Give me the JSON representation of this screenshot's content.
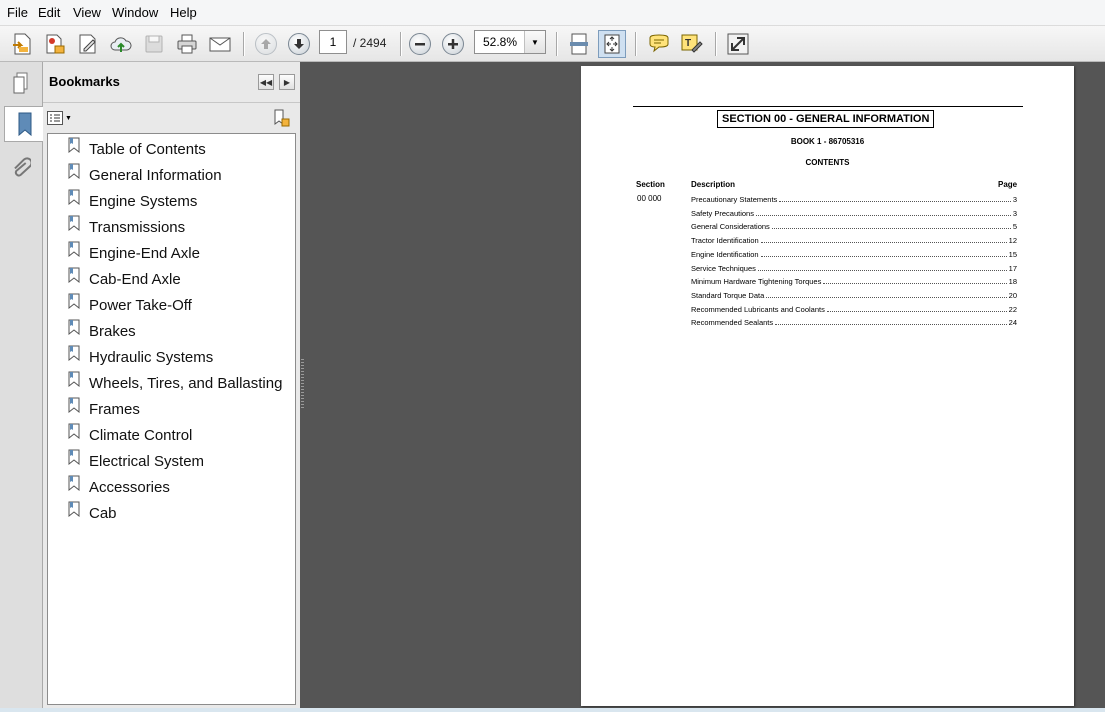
{
  "menu": [
    "File",
    "Edit",
    "View",
    "Window",
    "Help"
  ],
  "toolbar": {
    "page_current": "1",
    "page_total": "/ 2494",
    "zoom": "52.8%"
  },
  "panel": {
    "title": "Bookmarks"
  },
  "bookmarks": [
    "Table of Contents",
    "General Information",
    "Engine Systems",
    "Transmissions",
    "Engine-End Axle",
    "Cab-End Axle",
    "Power Take-Off",
    "Brakes",
    "Hydraulic Systems",
    "Wheels, Tires, and Ballasting",
    "Frames",
    "Climate Control",
    "Electrical System",
    "Accessories",
    "Cab"
  ],
  "document": {
    "section_title": "SECTION 00 - GENERAL INFORMATION",
    "book": "BOOK 1 - 86705316",
    "contents_heading": "CONTENTS",
    "col_section": "Section",
    "col_description": "Description",
    "col_page": "Page",
    "section_number": "00  000",
    "toc": [
      {
        "desc": "Precautionary Statements",
        "page": "3"
      },
      {
        "desc": "Safety Precautions",
        "page": "3"
      },
      {
        "desc": "General Considerations",
        "page": "5"
      },
      {
        "desc": "Tractor Identification",
        "page": "12"
      },
      {
        "desc": "Engine Identification",
        "page": "15"
      },
      {
        "desc": "Service Techniques",
        "page": "17"
      },
      {
        "desc": "Minimum Hardware Tightening Torques",
        "page": "18"
      },
      {
        "desc": "Standard Torque Data",
        "page": "20"
      },
      {
        "desc": "Recommended Lubricants and Coolants",
        "page": "22"
      },
      {
        "desc": "Recommended Sealants",
        "page": "24"
      }
    ]
  }
}
